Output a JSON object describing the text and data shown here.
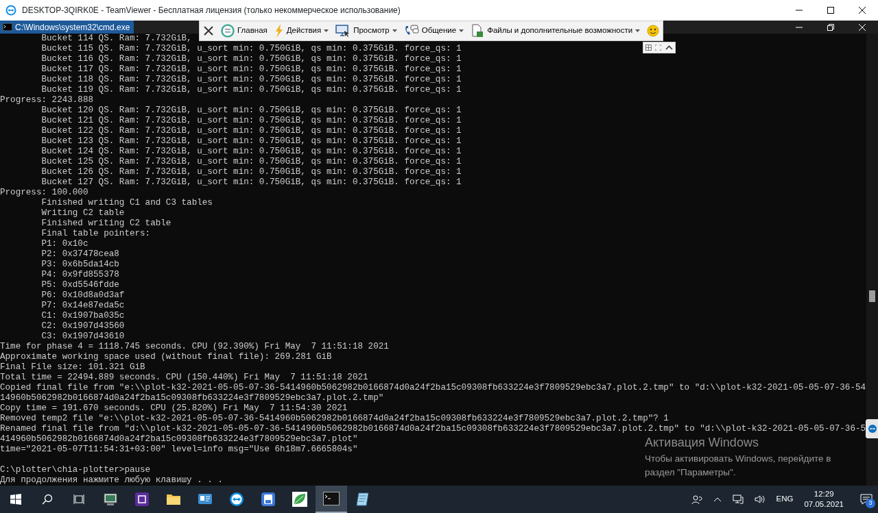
{
  "window": {
    "title": "DESKTOP-3QIRK0E - TeamViewer - Бесплатная лицензия (только некоммерческое использование)"
  },
  "console_window": {
    "title": "C:\\Windows\\system32\\cmd.exe"
  },
  "remote_toolbar": {
    "items": [
      {
        "label": "Главная",
        "kind": "home",
        "dropdown": false
      },
      {
        "label": "Действия",
        "kind": "actions",
        "dropdown": true
      },
      {
        "label": "Просмотр",
        "kind": "view",
        "dropdown": true
      },
      {
        "label": "Общение",
        "kind": "chat",
        "dropdown": true
      },
      {
        "label": "Файлы и дополнительные возможности",
        "kind": "files",
        "dropdown": true
      }
    ]
  },
  "console_lines": [
    "        Bucket 114 QS. Ram: 7.732GiB,",
    "        Bucket 115 QS. Ram: 7.732GiB, u_sort min: 0.750GiB, qs min: 0.375GiB. force_qs: 1",
    "        Bucket 116 QS. Ram: 7.732GiB, u_sort min: 0.750GiB, qs min: 0.375GiB. force_qs: 1",
    "        Bucket 117 QS. Ram: 7.732GiB, u_sort min: 0.750GiB, qs min: 0.375GiB. force_qs: 1",
    "        Bucket 118 QS. Ram: 7.732GiB, u_sort min: 0.750GiB, qs min: 0.375GiB. force_qs: 1",
    "        Bucket 119 QS. Ram: 7.732GiB, u_sort min: 0.750GiB, qs min: 0.375GiB. force_qs: 1",
    "Progress: 2243.888",
    "        Bucket 120 QS. Ram: 7.732GiB, u_sort min: 0.750GiB, qs min: 0.375GiB. force_qs: 1",
    "        Bucket 121 QS. Ram: 7.732GiB, u_sort min: 0.750GiB, qs min: 0.375GiB. force_qs: 1",
    "        Bucket 122 QS. Ram: 7.732GiB, u_sort min: 0.750GiB, qs min: 0.375GiB. force_qs: 1",
    "        Bucket 123 QS. Ram: 7.732GiB, u_sort min: 0.750GiB, qs min: 0.375GiB. force_qs: 1",
    "        Bucket 124 QS. Ram: 7.732GiB, u_sort min: 0.750GiB, qs min: 0.375GiB. force_qs: 1",
    "        Bucket 125 QS. Ram: 7.732GiB, u_sort min: 0.750GiB, qs min: 0.375GiB. force_qs: 1",
    "        Bucket 126 QS. Ram: 7.732GiB, u_sort min: 0.750GiB, qs min: 0.375GiB. force_qs: 1",
    "        Bucket 127 QS. Ram: 7.732GiB, u_sort min: 0.750GiB, qs min: 0.375GiB. force_qs: 1",
    "Progress: 100.000",
    "        Finished writing C1 and C3 tables",
    "        Writing C2 table",
    "        Finished writing C2 table",
    "        Final table pointers:",
    "        P1: 0x10c",
    "        P2: 0x37478cea8",
    "        P3: 0x6b5da14cb",
    "        P4: 0x9fd855378",
    "        P5: 0xd5546fdde",
    "        P6: 0x10d8a0d3af",
    "        P7: 0x14e87eda5c",
    "        C1: 0x1907ba035c",
    "        C2: 0x1907d43560",
    "        C3: 0x1907d43610",
    "Time for phase 4 = 1118.745 seconds. CPU (92.390%) Fri May  7 11:51:18 2021",
    "Approximate working space used (without final file): 269.281 GiB",
    "Final File size: 101.321 GiB",
    "Total time = 22494.889 seconds. CPU (150.440%) Fri May  7 11:51:18 2021",
    "Copied final file from \"e:\\\\plot-k32-2021-05-05-07-36-5414960b5062982b0166874d0a24f2ba15c09308fb633224e3f7809529ebc3a7.plot.2.tmp\" to \"d:\\\\plot-k32-2021-05-05-07-36-54",
    "14960b5062982b0166874d0a24f2ba15c09308fb633224e3f7809529ebc3a7.plot.2.tmp\"",
    "Copy time = 191.670 seconds. CPU (25.820%) Fri May  7 11:54:30 2021",
    "Removed temp2 file \"e:\\\\plot-k32-2021-05-05-07-36-5414960b5062982b0166874d0a24f2ba15c09308fb633224e3f7809529ebc3a7.plot.2.tmp\"? 1",
    "Renamed final file from \"d:\\\\plot-k32-2021-05-05-07-36-5414960b5062982b0166874d0a24f2ba15c09308fb633224e3f7809529ebc3a7.plot.2.tmp\" to \"d:\\\\plot-k32-2021-05-05-07-36-5",
    "414960b5062982b0166874d0a24f2ba15c09308fb633224e3f7809529ebc3a7.plot\"",
    "time=\"2021-05-07T11:54:31+03:00\" level=info msg=\"Use 6h18m7.6665804s\""
  ],
  "prompt_lines": [
    "C:\\plotter\\chia-plotter>pause",
    "Для продолжения нажмите любую клавишу . . ."
  ],
  "activation_notice": {
    "title": "Активация Windows",
    "text": "Чтобы активировать Windows, перейдите в раздел \"Параметры\"."
  },
  "taskbar": {
    "apps": [
      {
        "kind": "monitor",
        "selected": false
      },
      {
        "kind": "chip",
        "selected": false
      },
      {
        "kind": "folder",
        "selected": false
      },
      {
        "kind": "card",
        "selected": false
      },
      {
        "kind": "teamviewer",
        "selected": false
      },
      {
        "kind": "disk",
        "selected": false
      },
      {
        "kind": "leaf",
        "selected": false
      },
      {
        "kind": "terminal",
        "selected": true
      },
      {
        "kind": "notepad",
        "selected": false
      }
    ],
    "language": "ENG",
    "time": "12:29",
    "date": "07.05.2021",
    "notification_count": "3"
  }
}
